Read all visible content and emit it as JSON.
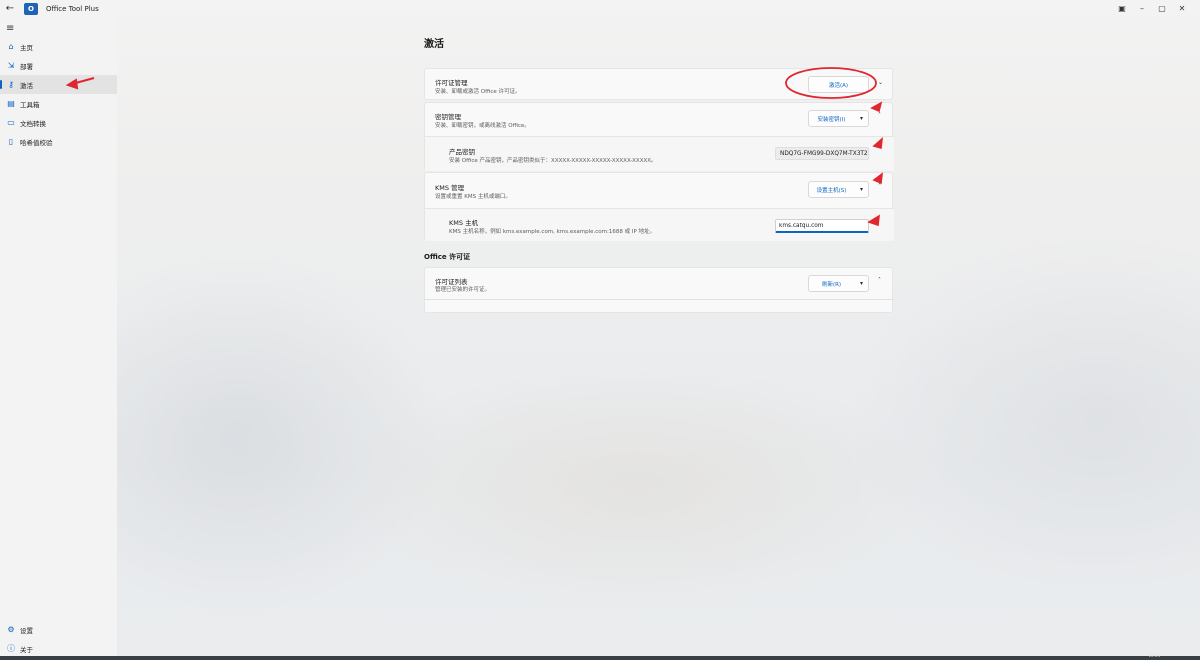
{
  "window": {
    "title": "Office Tool Plus",
    "back_icon": "back-arrow-icon",
    "logo_text": "O"
  },
  "sidebar": {
    "items": [
      {
        "label": "主页",
        "icon": "home-icon"
      },
      {
        "label": "部署",
        "icon": "deploy-icon"
      },
      {
        "label": "激活",
        "icon": "key-icon",
        "active": true
      },
      {
        "label": "工具箱",
        "icon": "toolbox-icon"
      },
      {
        "label": "文档转换",
        "icon": "document-icon"
      },
      {
        "label": "哈希值校验",
        "icon": "hash-icon"
      }
    ],
    "bottom_items": [
      {
        "label": "设置",
        "icon": "gear-icon"
      },
      {
        "label": "关于",
        "icon": "info-icon"
      }
    ]
  },
  "main": {
    "page_title": "激活",
    "license_management": {
      "title": "许可证管理",
      "subtitle": "安装、卸载或激活 Office 许可证。",
      "button_label": "激活(A)"
    },
    "key_management": {
      "title": "密钥管理",
      "subtitle": "安装、卸载密钥，或离线激活 Office。",
      "button_label": "安装密钥(I)",
      "product_key": {
        "label": "产品密钥",
        "description": "安装 Office 产品密钥，产品密钥类似于：XXXXX-XXXXX-XXXXX-XXXXX-XXXXX。",
        "value": "NDQ7G-FMG99-DXQ7M-TX3T2"
      }
    },
    "kms_management": {
      "title": "KMS 管理",
      "subtitle": "设置或重置 KMS 主机或端口。",
      "button_label": "设置主机(S)",
      "kms_host": {
        "label": "KMS 主机",
        "description": "KMS 主机名称，例如 kms.example.com, kms.example.com:1688 或 IP 地址。",
        "value": "kms.catqu.com"
      }
    },
    "office_license_section": "Office 许可证",
    "license_list": {
      "title": "许可证列表",
      "subtitle": "管理已安装的许可证。",
      "button_label": "刷新(R)"
    }
  },
  "taskbar": {
    "clock": "10:04"
  },
  "colors": {
    "accent": "#0b63c4",
    "annotation": "#e0262e"
  }
}
